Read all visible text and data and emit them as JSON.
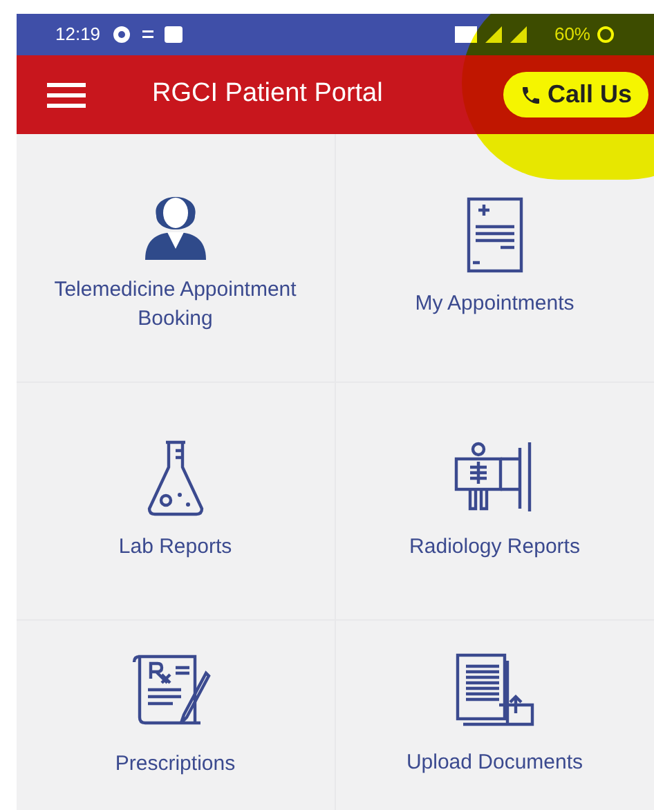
{
  "status_bar": {
    "time": "12:19",
    "battery": "60%"
  },
  "app_bar": {
    "title": "RGCI Patient Portal",
    "call_button": "Call Us"
  },
  "tiles": [
    {
      "label": "Telemedicine Appointment Booking"
    },
    {
      "label": "My Appointments"
    },
    {
      "label": "Lab Reports"
    },
    {
      "label": "Radiology Reports"
    },
    {
      "label": "Prescriptions"
    },
    {
      "label": "Upload Documents"
    }
  ]
}
